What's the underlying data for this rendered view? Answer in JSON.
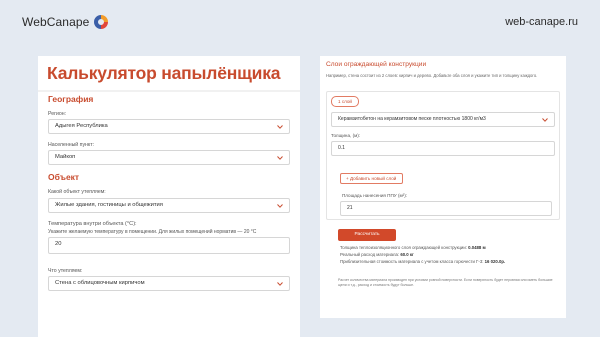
{
  "header": {
    "logo_text": "WebCanape",
    "site_url": "web-canape.ru"
  },
  "colors": {
    "accent": "#c84b2e",
    "button": "#d2492a",
    "background": "#e4eaf2",
    "logo_orange": "#f39c2a",
    "logo_red": "#e1473a",
    "logo_blue": "#3b5fa8"
  },
  "left": {
    "title": "Калькулятор напылёнщика",
    "geography": {
      "heading": "География",
      "region_label": "Регион:",
      "region_value": "Адыгея Республика",
      "city_label": "Населенный пункт:",
      "city_value": "Майкоп"
    },
    "object": {
      "heading": "Объект",
      "type_label": "Какой объект утепляем:",
      "type_value": "Жилые здания, гостиницы и общежития",
      "temp_label": "Температура внутри объекта (°C):",
      "temp_hint": "Укажите желаемую температуру в помещении. Для жилых помещений норматив — 20 °C",
      "temp_value": "20",
      "what_label": "Что утепляем:",
      "what_value": "Стена с облицовочным кирпичом"
    }
  },
  "right": {
    "title": "Слои ограждающей конструкции",
    "description": "Например, стена состоит из 2 слоев: кирпич и дерево. Добавьте оба слоя и укажите тип и толщину каждого.",
    "layer": {
      "badge": "1 слой",
      "material_value": "Керамзитобетон на керамзитовом песке плотностью 1800 кг/м3",
      "thickness_label": "Толщина, (м):",
      "thickness_value": "0.1"
    },
    "add_layer_label": "Добавить новый слой",
    "area_label": "Площадь нанесения ППУ (м²):",
    "area_value": "21",
    "calc_button": "Рассчитать",
    "results": {
      "line1_label": "Толщина теплоизоляционного слоя ограждающей конструкции:",
      "line1_value": "0.0488 м",
      "line2_label": "Реальный расход материала:",
      "line2_value": "60.0 кг",
      "line3_label": "Приблизительная стоимость материала с учетом класса горючести Г-3:",
      "line3_value": "16 020.0р."
    },
    "note": "Расчет количества материала производен при условии ровной поверхности. Если поверхность будет неровная или иметь большие щели и т.д., расход и стоимость будут больше."
  }
}
